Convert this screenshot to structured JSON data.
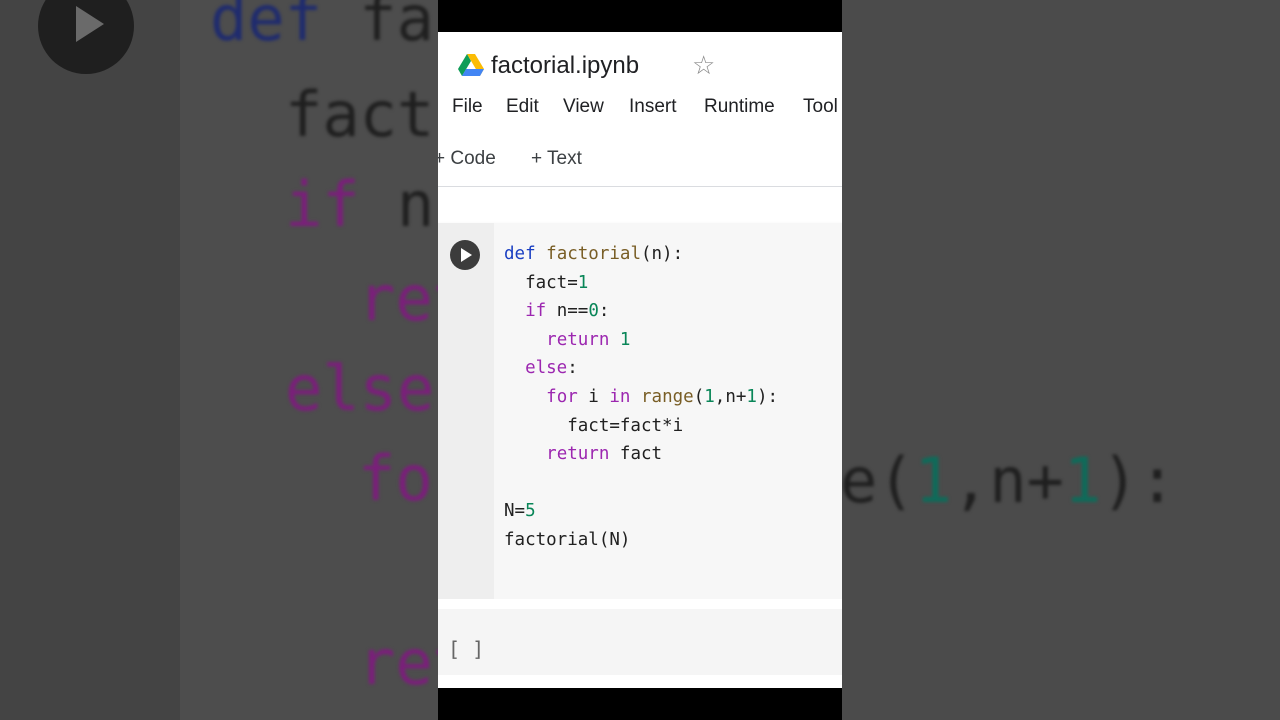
{
  "notebook": {
    "title": "factorial.ipynb"
  },
  "menu": [
    "File",
    "Edit",
    "View",
    "Insert",
    "Runtime",
    "Tool"
  ],
  "toolbar": {
    "code_label": "+ Code",
    "text_label": "+ Text"
  },
  "cell": {
    "code_lines": [
      "def factorial(n):",
      "  fact=1",
      "  if n==0:",
      "    return 1",
      "  else:",
      "    for i in range(1,n+1):",
      "      fact=fact*i",
      "    return fact",
      "",
      "N=5",
      "factorial(N)"
    ]
  },
  "output": {
    "prompt": "[ ]"
  },
  "colors": {
    "keyword": "#9c27b0",
    "def": "#1a3fc2",
    "number": "#098658",
    "function": "#795e26"
  }
}
